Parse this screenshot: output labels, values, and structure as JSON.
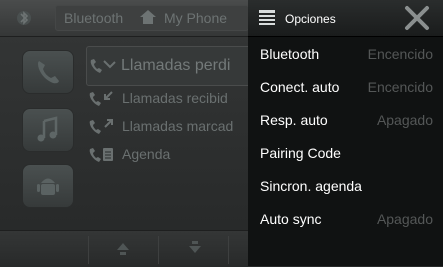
{
  "background_app": {
    "tabs": {
      "bluetooth": "Bluetooth",
      "phone": "My Phone"
    },
    "list_items": [
      {
        "label": "Llamadas perdi",
        "icon": "missed-call-icon"
      },
      {
        "label": "Llamadas recibid",
        "icon": "received-call-icon"
      },
      {
        "label": "Llamadas marcad",
        "icon": "dialed-call-icon"
      },
      {
        "label": "Agenda",
        "icon": "phonebook-icon"
      }
    ],
    "side_buttons": [
      "phone-app-icon",
      "music-icon",
      "android-icon"
    ]
  },
  "options": {
    "title": "Opciones",
    "items": [
      {
        "label": "Bluetooth",
        "value": "Encencido"
      },
      {
        "label": "Conect. auto",
        "value": "Encencido"
      },
      {
        "label": "Resp. auto",
        "value": "Apagado"
      },
      {
        "label": "Pairing Code",
        "value": ""
      },
      {
        "label": "Sincron. agenda",
        "value": ""
      },
      {
        "label": "Auto sync",
        "value": "Apagado"
      }
    ]
  },
  "colors": {
    "overlay_bg": "#101212",
    "value_text": "#545757",
    "label_text": "#ffffff"
  }
}
